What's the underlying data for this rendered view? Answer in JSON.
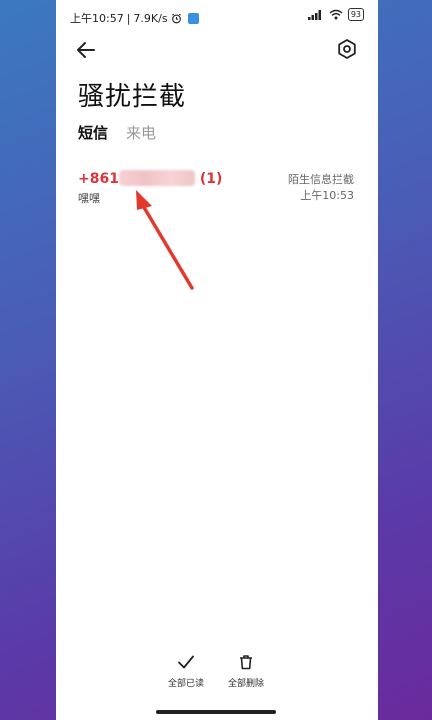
{
  "status_bar": {
    "time": "上午10:57",
    "separator": "|",
    "speed": "7.9K/s",
    "battery": "93"
  },
  "header": {
    "title": "骚扰拦截"
  },
  "tabs": [
    {
      "label": "短信",
      "active": true
    },
    {
      "label": "来电",
      "active": false
    }
  ],
  "messages": [
    {
      "sender_prefix": "+861",
      "sender_suffix": "(1)",
      "preview": "嘿嘿",
      "tag": "陌生信息拦截",
      "time": "上午10:53"
    }
  ],
  "actions": {
    "mark_all_read": "全部已读",
    "delete_all": "全部删除"
  },
  "colors": {
    "accent_red": "#d9353a",
    "annotation_arrow": "#e2392c"
  }
}
